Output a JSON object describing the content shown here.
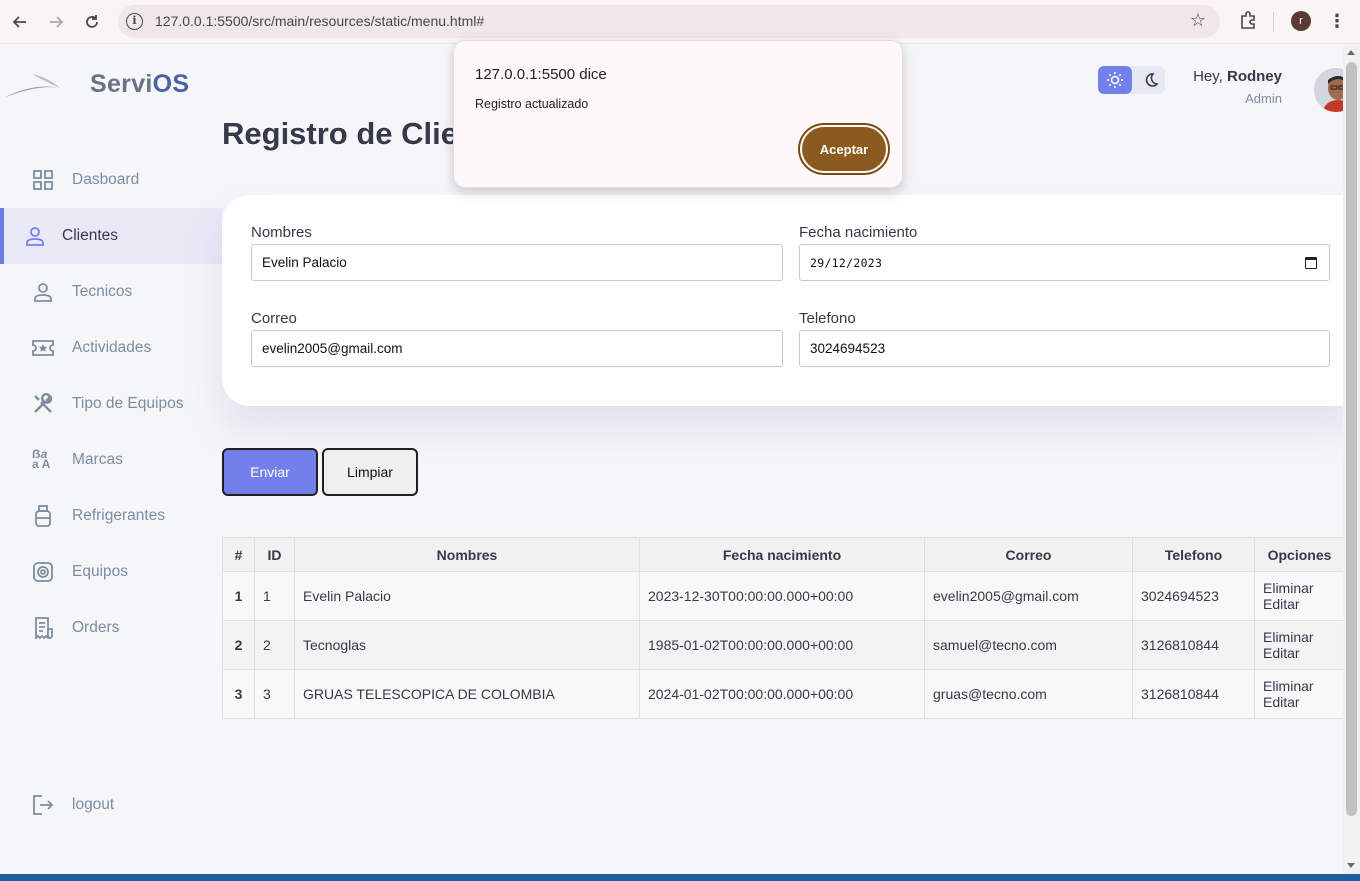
{
  "browser": {
    "url": "127.0.0.1:5500/src/main/resources/static/menu.html#",
    "profile_initial": "r"
  },
  "brand": {
    "name_a": "Servi",
    "name_b": "OS"
  },
  "sidebar": {
    "items": [
      {
        "label": "Dasboard",
        "icon": "grid-icon"
      },
      {
        "label": "Clientes",
        "icon": "person-icon",
        "active": true
      },
      {
        "label": "Tecnicos",
        "icon": "person-icon"
      },
      {
        "label": "Actividades",
        "icon": "ticket-icon"
      },
      {
        "label": "Tipo de Equipos",
        "icon": "tools-icon"
      },
      {
        "label": "Marcas",
        "icon": "translate-icon"
      },
      {
        "label": "Refrigerantes",
        "icon": "tank-icon"
      },
      {
        "label": "Equipos",
        "icon": "device-icon"
      },
      {
        "label": "Orders",
        "icon": "receipt-icon"
      }
    ],
    "logout_label": "logout"
  },
  "header": {
    "greeting": "Hey, ",
    "user_name": "Rodney",
    "role": "Admin"
  },
  "page": {
    "title": "Registro de Clientes"
  },
  "form": {
    "nombres_label": "Nombres",
    "nombres_value": "Evelin Palacio",
    "fecha_label": "Fecha nacimiento",
    "fecha_value": "29/12/2023",
    "correo_label": "Correo",
    "correo_value": "evelin2005@gmail.com",
    "telefono_label": "Telefono",
    "telefono_value": "3024694523",
    "send_label": "Enviar",
    "clear_label": "Limpiar"
  },
  "table": {
    "headers": [
      "#",
      "ID",
      "Nombres",
      "Fecha nacimiento",
      "Correo",
      "Telefono",
      "Opciones"
    ],
    "rows": [
      {
        "n": "1",
        "id": "1",
        "nombres": "Evelin Palacio",
        "fecha": "2023-12-30T00:00:00.000+00:00",
        "correo": "evelin2005@gmail.com",
        "telefono": "3024694523",
        "delete": "Eliminar",
        "edit": "Editar"
      },
      {
        "n": "2",
        "id": "2",
        "nombres": "Tecnoglas",
        "fecha": "1985-01-02T00:00:00.000+00:00",
        "correo": "samuel@tecno.com",
        "telefono": "3126810844",
        "delete": "Eliminar",
        "edit": "Editar"
      },
      {
        "n": "3",
        "id": "3",
        "nombres": "GRUAS TELESCOPICA DE COLOMBIA",
        "fecha": "2024-01-02T00:00:00.000+00:00",
        "correo": "gruas@tecno.com",
        "telefono": "3126810844",
        "delete": "Eliminar",
        "edit": "Editar"
      }
    ]
  },
  "dialog": {
    "title": "127.0.0.1:5500 dice",
    "message": "Registro actualizado",
    "button": "Aceptar"
  },
  "colors": {
    "primary": "#7380ec",
    "dialog_button": "#8b5a1e",
    "active_bg": "#e8e9f5"
  }
}
